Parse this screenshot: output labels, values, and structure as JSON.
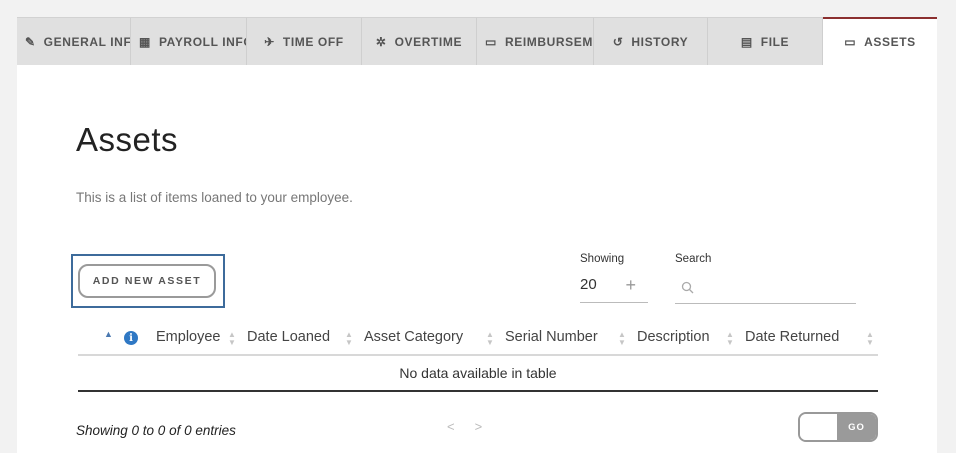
{
  "tabs": [
    {
      "label": "GENERAL INFO",
      "icon": "pencil-icon",
      "glyph": "✎"
    },
    {
      "label": "PAYROLL INFO",
      "icon": "calculator-icon",
      "glyph": "▦"
    },
    {
      "label": "TIME OFF",
      "icon": "plane-icon",
      "glyph": "✈"
    },
    {
      "label": "OVERTIME",
      "icon": "gear-icon",
      "glyph": "✲"
    },
    {
      "label": "REIMBURSEMENTS",
      "icon": "credit-card-icon",
      "glyph": "▭"
    },
    {
      "label": "HISTORY",
      "icon": "history-icon",
      "glyph": "↺"
    },
    {
      "label": "FILE",
      "icon": "archive-icon",
      "glyph": "▤"
    },
    {
      "label": "ASSETS",
      "icon": "laptop-icon",
      "glyph": "▭",
      "active": true
    }
  ],
  "page": {
    "title": "Assets",
    "subtitle": "This is a list of items loaned to your employee."
  },
  "actions": {
    "add_label": "ADD NEW ASSET"
  },
  "controls": {
    "showing_label": "Showing",
    "showing_value": "20",
    "search_label": "Search",
    "search_placeholder": ""
  },
  "table": {
    "columns": [
      "Employee",
      "Date Loaned",
      "Asset Category",
      "Serial Number",
      "Description",
      "Date Returned"
    ],
    "empty_message": "No data available in table"
  },
  "footer": {
    "info": "Showing 0 to 0 of 0 entries",
    "prev": "<",
    "next": ">",
    "go_label": "GO"
  },
  "colors": {
    "active_tab_border": "#8b2f2f",
    "focus_ring": "#3d6b9b",
    "info_icon": "#2f78c4"
  }
}
